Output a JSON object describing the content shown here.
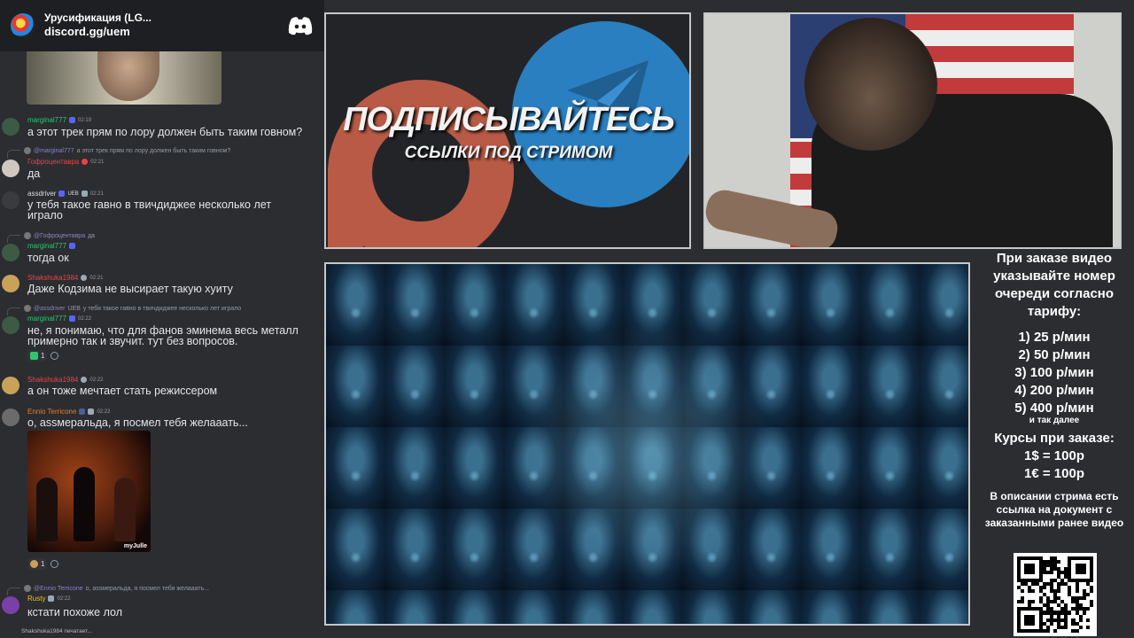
{
  "server": {
    "name": "Урусификация (LG...",
    "invite": "discord.gg/uem"
  },
  "messages": [
    {
      "username": "marginal777",
      "color": "#2dc770",
      "time": "02:19",
      "text": "а этот трек прям по лору должен быть таким говном?"
    },
    {
      "reply_to": "@marginal777",
      "reply_text": "а этот трек прям по лору должен быть таким говном?",
      "username": "Гофроцентавра",
      "color": "#ed4245",
      "time": "02:21",
      "text": "да"
    },
    {
      "username": "assdriver",
      "color": "#dbdee1",
      "tag": "UEB",
      "time": "02:21",
      "text": "у тебя такое гавно в твичдиджее несколько лет играло"
    },
    {
      "reply_to": "@Гофроцентавра",
      "reply_text": "да",
      "username": "marginal777",
      "color": "#2dc770",
      "time": "",
      "text": "тогда ок"
    },
    {
      "username": "Shakshuka1984",
      "color": "#ed4245",
      "time": "02:21",
      "text": "Даже Кодзима не высирает такую хуиту"
    },
    {
      "reply_to": "@assdriver",
      "reply_tag": "UEB",
      "reply_text": "у тебя такое гавно в твичдиджее несколько лет играло",
      "username": "marginal777",
      "color": "#2dc770",
      "time": "02:22",
      "text": "не, я понимаю, что для фанов эминема весь металл примерно так и звучит. тут без вопросов."
    },
    {
      "username": "Shakshuka1984",
      "color": "#ed4245",
      "time": "02:22",
      "text": "а он тоже мечтает стать режиссером"
    },
    {
      "username": "Ennio Terricone",
      "color": "#e67e22",
      "time": "02:22",
      "text": "о, assмеральда, я посмел тебя желааать..."
    },
    {
      "reply_to": "@Ennio Terricone",
      "reply_text": "о, assмеральда, я посмел тебя желааать...",
      "username": "Rusty",
      "color": "#f1c40f",
      "time": "02:22",
      "text": "кстати похоже лол"
    }
  ],
  "reactions": [
    {
      "count": "1"
    },
    {
      "count": "1"
    }
  ],
  "meme_label": "myJulle",
  "typing": "Shakshuka1984 печатает...",
  "promo": {
    "title": "ПОДПИСЫВАЙТЕСЬ",
    "subtitle": "ССЫЛКИ ПОД СТРИМОМ"
  },
  "info": {
    "intro": "При заказе видео указывайте номер очереди согласно тарифу:",
    "tariffs": [
      "1) 25 р/мин",
      "2) 50 р/мин",
      "3) 100 р/мин",
      "4) 200 р/мин",
      "5) 400 р/мин"
    ],
    "tariff_etc": "и так далее",
    "rates_title": "Курсы при заказе:",
    "rates": [
      "1$ = 100р",
      "1€ = 100р"
    ],
    "doc_note": "В описании стрима есть ссылка на документ с заказанными ранее видео"
  },
  "colors": {
    "discord_bg": "#2b2d31",
    "header_bg": "#1e1f22",
    "telegram": "#2a7fc0",
    "patreon": "#b85a46"
  }
}
